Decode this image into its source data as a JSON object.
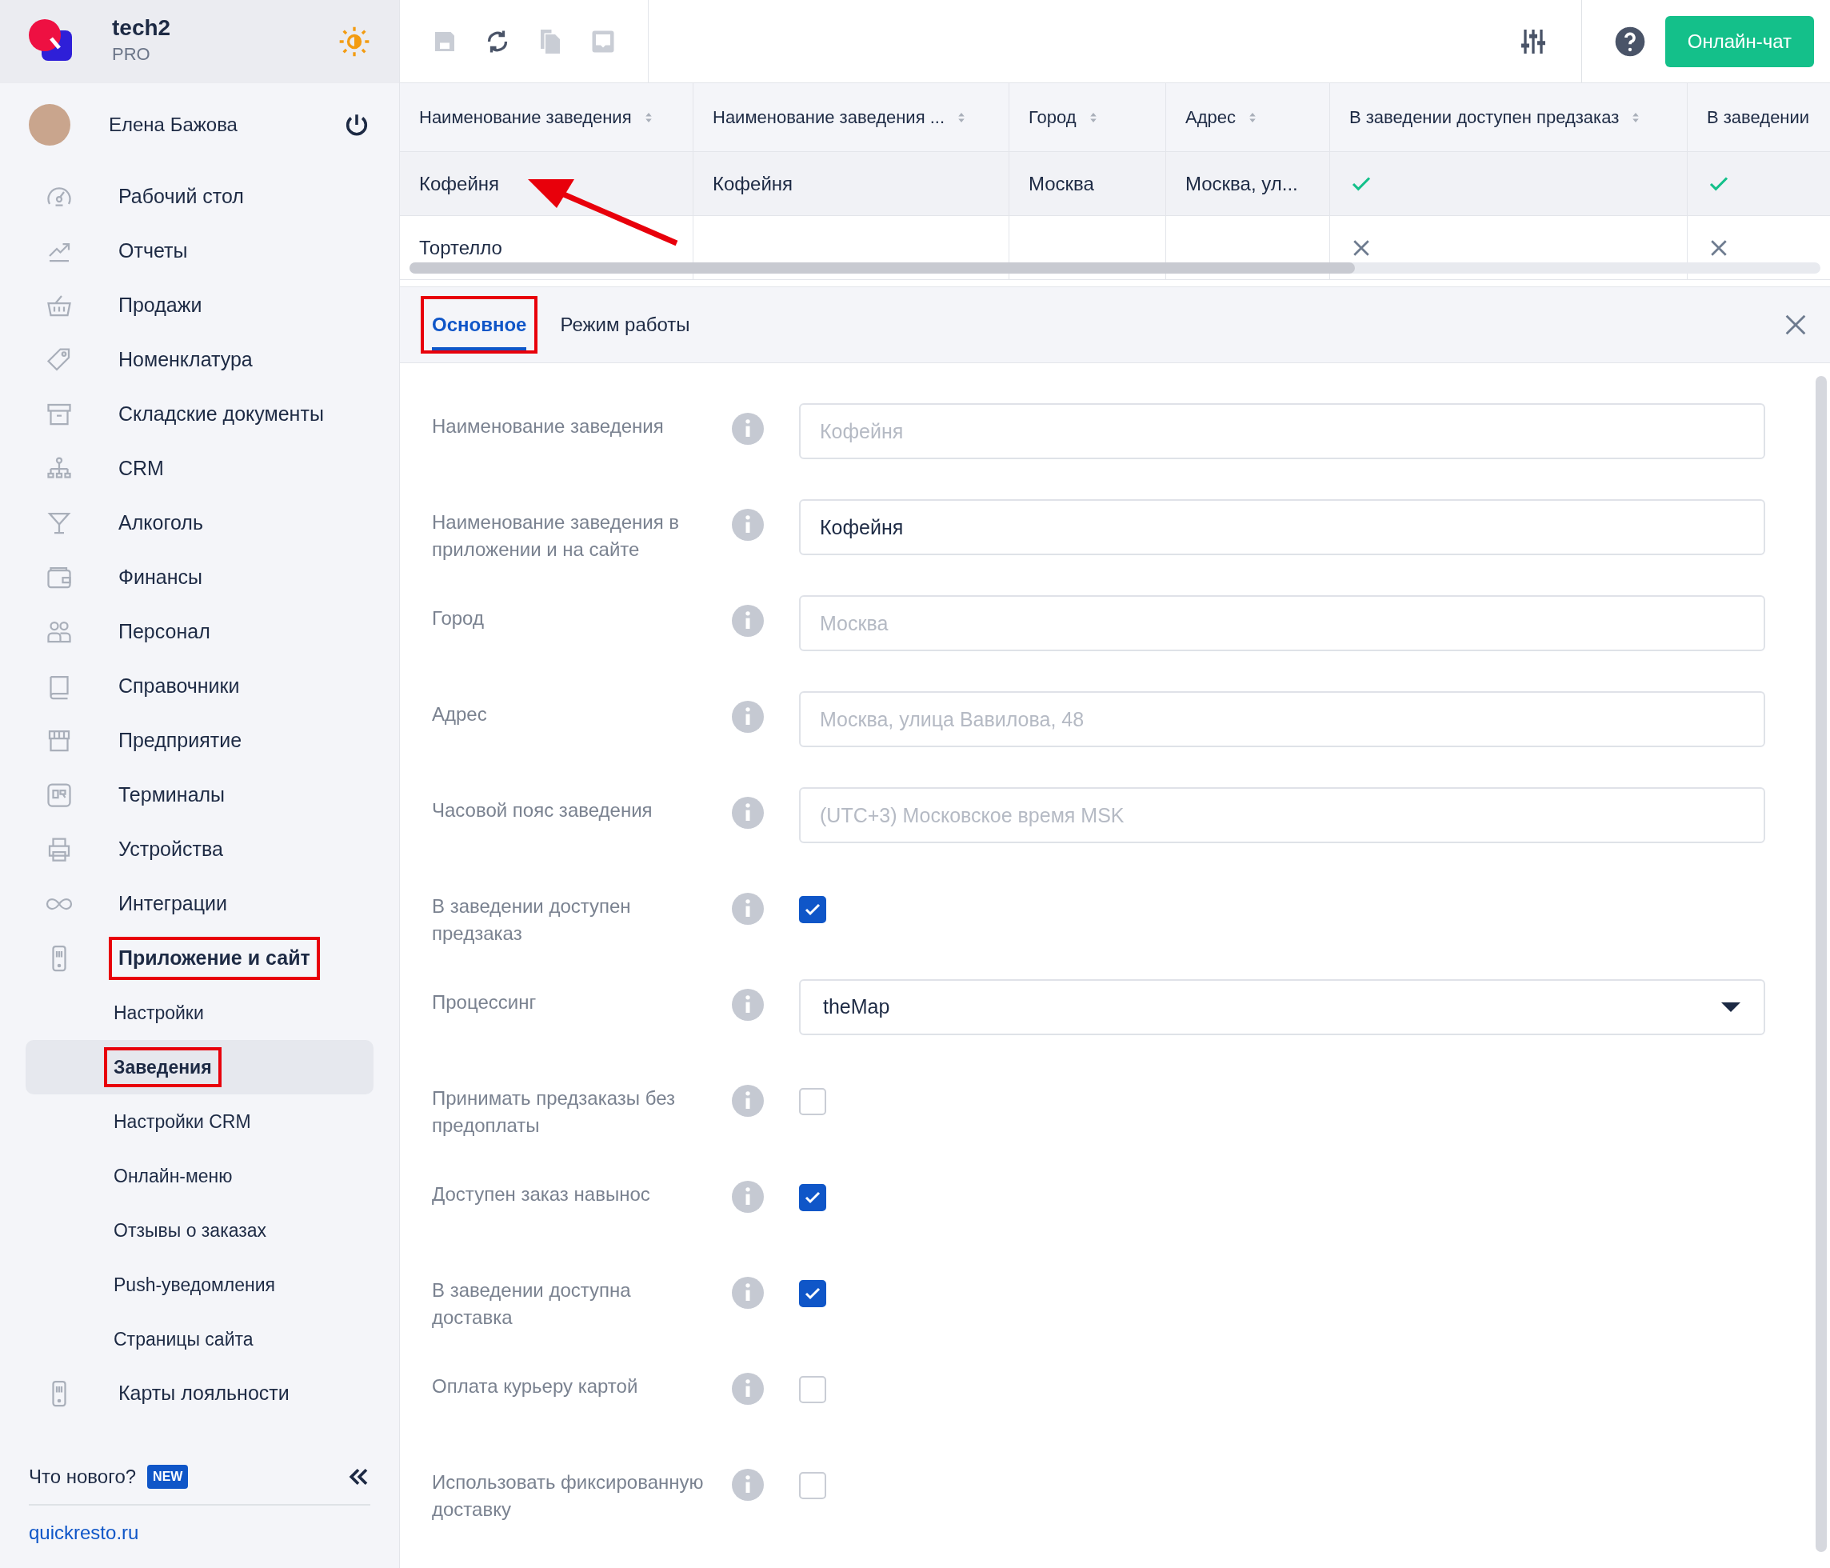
{
  "brand": {
    "name": "tech2",
    "plan": "PRO"
  },
  "user": {
    "name": "Елена Бажова"
  },
  "sidebar": {
    "items": [
      {
        "label": "Рабочий стол",
        "selected": false,
        "highlighted": false
      },
      {
        "label": "Отчеты",
        "selected": false,
        "highlighted": false
      },
      {
        "label": "Продажи",
        "selected": false,
        "highlighted": false
      },
      {
        "label": "Номенклатура",
        "selected": false,
        "highlighted": false
      },
      {
        "label": "Складские документы",
        "selected": false,
        "highlighted": false
      },
      {
        "label": "CRM",
        "selected": false,
        "highlighted": false
      },
      {
        "label": "Алкоголь",
        "selected": false,
        "highlighted": false
      },
      {
        "label": "Финансы",
        "selected": false,
        "highlighted": false
      },
      {
        "label": "Персонал",
        "selected": false,
        "highlighted": false
      },
      {
        "label": "Справочники",
        "selected": false,
        "highlighted": false
      },
      {
        "label": "Предприятие",
        "selected": false,
        "highlighted": false
      },
      {
        "label": "Терминалы",
        "selected": false,
        "highlighted": false
      },
      {
        "label": "Устройства",
        "selected": false,
        "highlighted": false
      },
      {
        "label": "Интеграции",
        "selected": false,
        "highlighted": false
      },
      {
        "label": "Приложение и сайт",
        "selected": true,
        "highlighted": true,
        "children": [
          {
            "label": "Настройки",
            "selected": false,
            "highlighted": false
          },
          {
            "label": "Заведения",
            "selected": true,
            "highlighted": true
          },
          {
            "label": "Настройки CRM",
            "selected": false,
            "highlighted": false
          },
          {
            "label": "Онлайн-меню",
            "selected": false,
            "highlighted": false
          },
          {
            "label": "Отзывы о заказах",
            "selected": false,
            "highlighted": false
          },
          {
            "label": "Push-уведомления",
            "selected": false,
            "highlighted": false
          },
          {
            "label": "Страницы сайта",
            "selected": false,
            "highlighted": false
          }
        ]
      },
      {
        "label": "Карты лояльности",
        "selected": false,
        "highlighted": false
      }
    ],
    "whats_new": "Что нового?",
    "new_badge": "NEW",
    "footer_link": "quickresto.ru"
  },
  "toolbar": {
    "chat_button": "Онлайн-чат"
  },
  "table": {
    "columns": [
      "Наименование заведения",
      "Наименование заведения ...",
      "Город",
      "Адрес",
      "В заведении доступен предзаказ",
      "В заведении"
    ],
    "rows": [
      {
        "selected": true,
        "cells": [
          "Кофейня",
          "Кофейня",
          "Москва",
          "Москва, ул..."
        ],
        "flags": [
          true,
          true
        ]
      },
      {
        "selected": false,
        "cells": [
          "Тортелло"
        ],
        "flags": [
          false,
          false
        ]
      }
    ]
  },
  "tabs": [
    {
      "label": "Основное",
      "selected": true,
      "highlighted": true
    },
    {
      "label": "Режим работы",
      "selected": false,
      "highlighted": false
    }
  ],
  "form": [
    {
      "kind": "text",
      "label": "Наименование заведения",
      "value": "Кофейня",
      "disabled": true
    },
    {
      "kind": "text",
      "label": "Наименование заведения в приложении и на сайте",
      "value": "Кофейня",
      "disabled": false
    },
    {
      "kind": "text",
      "label": "Город",
      "value": "Москва",
      "disabled": true
    },
    {
      "kind": "text",
      "label": "Адрес",
      "value": "Москва, улица Вавилова, 48",
      "disabled": true
    },
    {
      "kind": "text",
      "label": "Часовой пояс заведения",
      "value": "(UTC+3) Московское время MSK",
      "disabled": true
    },
    {
      "kind": "checkbox",
      "label": "В заведении доступен предзаказ",
      "checked": true
    },
    {
      "kind": "select",
      "label": "Процессинг",
      "value": "theMap"
    },
    {
      "kind": "checkbox",
      "label": "Принимать предзаказы без предоплаты",
      "checked": false
    },
    {
      "kind": "checkbox",
      "label": "Доступен заказ навынос",
      "checked": true
    },
    {
      "kind": "checkbox",
      "label": "В заведении доступна доставка",
      "checked": true
    },
    {
      "kind": "checkbox",
      "label": "Оплата курьеру картой",
      "checked": false
    },
    {
      "kind": "checkbox",
      "label": "Использовать фиксированную доставку",
      "checked": false
    }
  ]
}
